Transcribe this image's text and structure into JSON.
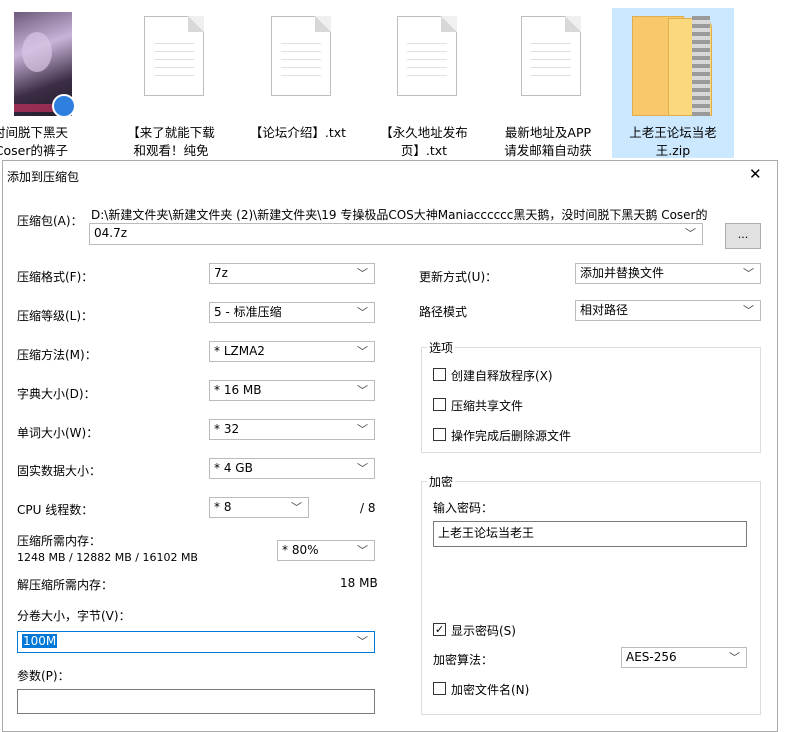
{
  "explorer": {
    "files": [
      {
        "line1": "没时间脱下黑天",
        "line2": "鹅 Coser的裤子",
        "icon": "video-thumbnail"
      },
      {
        "line1": "【来了就能下载",
        "line2": "和观看！纯免",
        "icon": "text-file-icon"
      },
      {
        "line1": "【论坛介绍】.txt",
        "line2": "",
        "icon": "text-file-icon"
      },
      {
        "line1": "【永久地址发布",
        "line2": "页】.txt",
        "icon": "text-file-icon"
      },
      {
        "line1": "最新地址及APP",
        "line2": "请发邮箱自动获",
        "icon": "text-file-icon"
      },
      {
        "line1": "上老王论坛当老",
        "line2": "王.zip",
        "icon": "zip-folder-icon"
      }
    ]
  },
  "dialog": {
    "title": "添加到压缩包",
    "close_glyph": "✕",
    "archive": {
      "label": "压缩包(A)：",
      "path": "D:\\新建文件夹\\新建文件夹 (2)\\新建文件夹\\19 专操极品COS大神Maniacccccc黑天鹅，没时间脱下黑天鹅 Coser的",
      "name": "04.7z",
      "browse_label": "..."
    },
    "left": {
      "format": {
        "label": "压缩格式(F)：",
        "value": "7z"
      },
      "level": {
        "label": "压缩等级(L)：",
        "value": "5 - 标准压缩"
      },
      "method": {
        "label": "压缩方法(M)：",
        "value": "* LZMA2"
      },
      "dict": {
        "label": "字典大小(D)：",
        "value": "* 16 MB"
      },
      "word": {
        "label": "单词大小(W)：",
        "value": "* 32"
      },
      "solid": {
        "label": "固实数据大小：",
        "value": "* 4 GB"
      },
      "threads": {
        "label": "CPU 线程数：",
        "value": "* 8",
        "max": "/ 8"
      },
      "mem_compress": {
        "label": "压缩所需内存：",
        "detail": "1248 MB / 12882 MB / 16102 MB",
        "value": "* 80%"
      },
      "mem_decompress": {
        "label": "解压缩所需内存：",
        "value": "18 MB"
      },
      "volume": {
        "label": "分卷大小，字节(V)：",
        "value": "100M"
      },
      "params": {
        "label": "参数(P)：",
        "value": ""
      }
    },
    "right": {
      "update": {
        "label": "更新方式(U)：",
        "value": "添加并替换文件"
      },
      "path_mode": {
        "label": "路径模式",
        "value": "相对路径"
      },
      "options": {
        "title": "选项",
        "sfx": {
          "label": "创建自释放程序(X)",
          "checked": false
        },
        "shared": {
          "label": "压缩共享文件",
          "checked": false
        },
        "delete": {
          "label": "操作完成后删除源文件",
          "checked": false
        }
      },
      "encryption": {
        "title": "加密",
        "password_label": "输入密码：",
        "password_value": "上老王论坛当老王",
        "show_password": {
          "label": "显示密码(S)",
          "checked": true
        },
        "method": {
          "label": "加密算法：",
          "value": "AES-256"
        },
        "encrypt_names": {
          "label": "加密文件名(N)",
          "checked": false
        }
      }
    },
    "colors": {
      "selection": "#cce8ff",
      "highlight": "#0078d7"
    }
  }
}
